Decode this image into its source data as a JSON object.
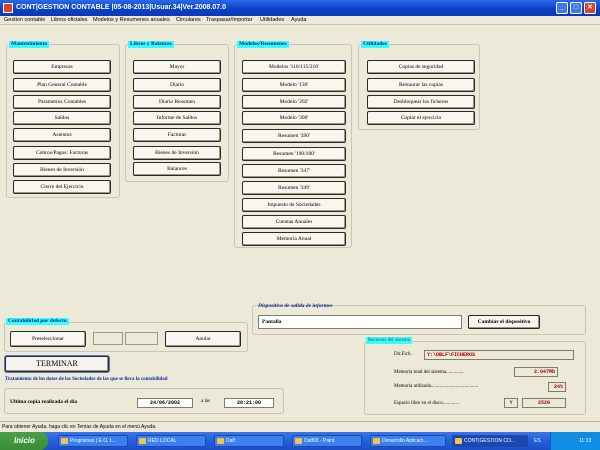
{
  "window": {
    "title": "CONT|GESTION CONTABLE                    |05-08-2013|Usuar.34|Ver.2008.07.0",
    "minimize": "_",
    "maximize": "□",
    "close": "✕"
  },
  "menu": [
    "Gestion contable",
    "Libros oficiales",
    "Modelos y Resumenes anuales",
    "Circulares",
    "Traspasar/Importar",
    "Utilidades",
    "Ayuda"
  ],
  "mantenimiento": {
    "header": "Mantenimiento",
    "buttons": [
      "Empresas",
      "Plan General Contable",
      "Parametros Contables",
      "Saldos",
      "Asientos",
      "Cobros/Pagos: Facturas",
      "Bienes de Inversión",
      "Cierre del Ejercicio"
    ]
  },
  "libros": {
    "header": "Libros y Balances",
    "buttons": [
      "Mayor",
      "Diario",
      "Diario Resumen",
      "Informe de Saldos",
      "Facturar",
      "Bienes de Inversión",
      "Balances"
    ]
  },
  "modelos": {
    "header": "Modelos/Resumenes",
    "buttons": [
      "Modelos '110/115/216'",
      "Modelo '130'",
      "Modelo '202'",
      "Modelo '300'",
      "Resumen '390'",
      "Resumen '190/180'",
      "Resumen '347'",
      "Resumen '349'",
      "Impuesto de Sociedades",
      "Cuentas Anuales",
      "Memoria Anual"
    ]
  },
  "utilidades": {
    "header": "Utilidades",
    "buttons": [
      "Copias de seguridad",
      "Restaurar las copias",
      "Desbloquear los ficheros",
      "Copiar el ejercicio"
    ]
  },
  "contabilidad": {
    "header": "Contabilidad por defecto",
    "preseleccionar": "Preseleccionar",
    "anular": "Anular"
  },
  "dispositivo": {
    "header": "Dispositivo de salida de informes",
    "value": "Pantalla",
    "cambiar": "Cambiar el dispositivo"
  },
  "terminar": "TERMINAR",
  "tratamiento": "Tratamiento de los datos de las Sociedades de las que se lleva la contabilidad",
  "copia": {
    "label": "Ultima copia realizada el dia",
    "date": "24/06/2002",
    "a_las": "a las",
    "time": "20:21:00"
  },
  "recursos": {
    "header": "Recursos del sistema",
    "dirfich_label": "Dir.Fich.",
    "dirfich": "Y:\\DBLF\\FICHEROS",
    "memoria_label": "Memoria total del sistema..............",
    "memoria": "2.047Mb",
    "utilizada_label": "Memoria utilizada......................................",
    "utilizada": "24%",
    "espacio_label": "Espacio libre en el disco.............",
    "unidad": "Y",
    "espacio": "252G"
  },
  "status_bar": "Para obtener Ayuda, haga clic en Temas de Ayuda en el menú Ayuda.",
  "taskbar": {
    "start": "Inicio",
    "tasks": [
      "Programas | E.O. I...",
      "RED LOCAL",
      "Dalf",
      "Dalf03 - Paint",
      "Desarrollo Aplicaci...",
      "CONT|GESTION CO..."
    ],
    "lang": "ES",
    "clock": "11:13"
  },
  "colors": {
    "header_bg": "#33ffff",
    "header_text": "#0a1a8a",
    "field_text": "#b00000",
    "titlebar": "#0a3fc6"
  }
}
